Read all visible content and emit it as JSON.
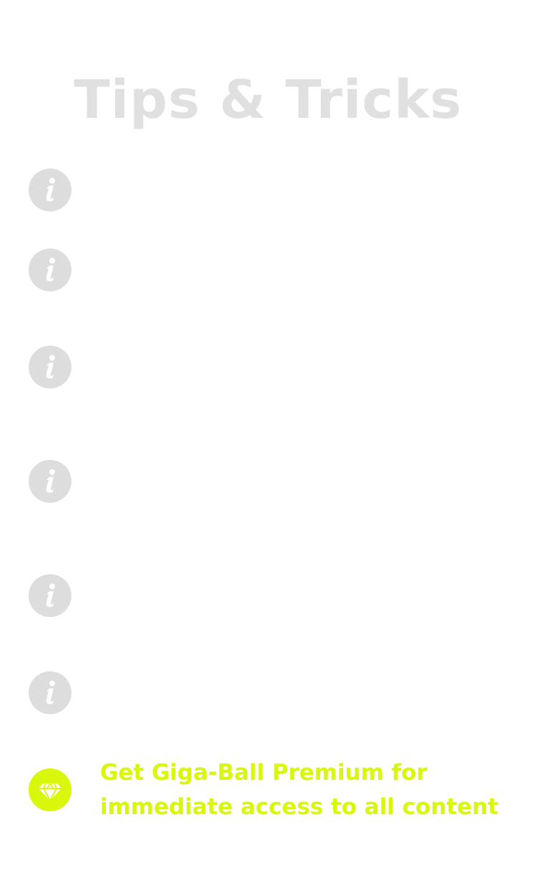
{
  "page": {
    "title": "Tips & Tricks"
  },
  "tips": [
    {
      "icon": "info-icon"
    },
    {
      "icon": "info-icon"
    },
    {
      "icon": "info-icon"
    },
    {
      "icon": "info-icon"
    },
    {
      "icon": "info-icon"
    },
    {
      "icon": "info-icon"
    }
  ],
  "promo": {
    "icon": "diamond-icon",
    "line1": "Get Giga-Ball Premium for",
    "line2": "immediate access to all content"
  },
  "colors": {
    "title": "#e0e0e0",
    "info_icon": "#dddddd",
    "accent": "#d8f70a"
  }
}
